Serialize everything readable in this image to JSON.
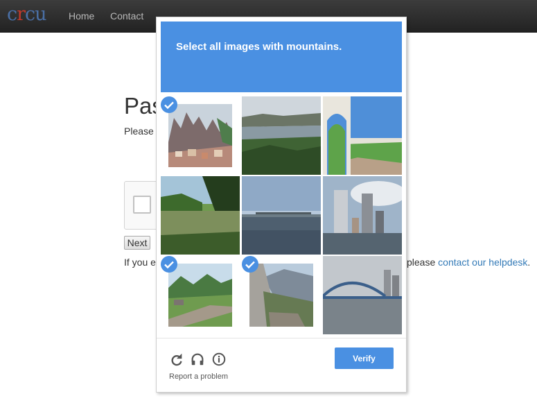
{
  "site": {
    "logo_text": "crcu",
    "nav": [
      {
        "label": "Home"
      },
      {
        "label": "Contact"
      }
    ]
  },
  "page": {
    "title_visible": "Pas",
    "subtitle_visible": "Please f",
    "next_label": "Next",
    "help_prefix_visible": "If you er",
    "help_suffix_visible": "please ",
    "help_link": "contact our helpdesk",
    "help_end": "."
  },
  "challenge": {
    "instruction_prefix": "Select all images with ",
    "instruction_target": "mountains",
    "instruction_end": ".",
    "tiles": [
      {
        "subject": "rocky mountain village",
        "selected": true
      },
      {
        "subject": "river valley landscape",
        "selected": false
      },
      {
        "subject": "arched terrace by the sea",
        "selected": false
      },
      {
        "subject": "forest pond",
        "selected": false
      },
      {
        "subject": "bridge over water",
        "selected": false
      },
      {
        "subject": "city skyline on river",
        "selected": false
      },
      {
        "subject": "green mountain road",
        "selected": true
      },
      {
        "subject": "rocky cliff mountain",
        "selected": true
      },
      {
        "subject": "arched bridge over river",
        "selected": false
      }
    ],
    "controls": {
      "reload_icon": "reload-icon",
      "audio_icon": "headphones-icon",
      "info_icon": "info-icon"
    },
    "report_label": "Report a problem",
    "verify_label": "Verify"
  },
  "colors": {
    "accent": "#4a90e2",
    "navbar": "#2d2d2d",
    "link": "#337ab7"
  }
}
